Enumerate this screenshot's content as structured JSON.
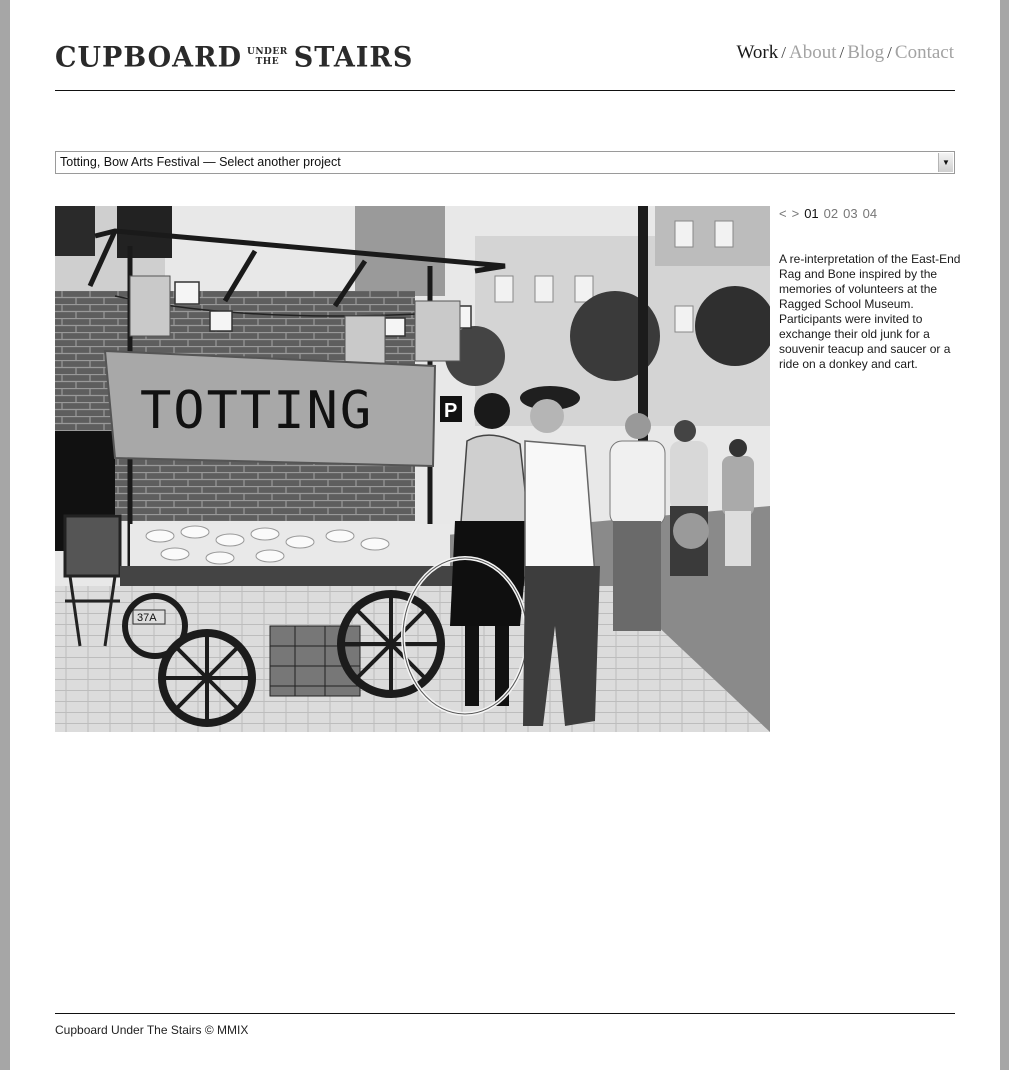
{
  "header": {
    "logo_left": "CUPBOARD",
    "logo_top": "UNDER",
    "logo_mid": "THE",
    "logo_right": "STAIRS",
    "nav": [
      {
        "label": "Work",
        "active": true
      },
      {
        "label": "About",
        "active": false
      },
      {
        "label": "Blog",
        "active": false
      },
      {
        "label": "Contact",
        "active": false
      }
    ],
    "separator": "/"
  },
  "project_select": {
    "value": "Totting, Bow Arts Festival — Select another project",
    "arrow": "▼"
  },
  "photo": {
    "banner_text": "TOTTING",
    "sign_text": "P",
    "cart_number": "37A"
  },
  "pager": {
    "prev": "<",
    "next": ">",
    "pages": [
      "01",
      "02",
      "03",
      "04"
    ],
    "current": "01"
  },
  "description": "A re-interpretation of the East-End Rag and Bone inspired by the memories of volunteers at the Ragged School Museum. Participants were invited to exchange their old junk for a souvenir teacup and saucer or a ride on a donkey and cart.",
  "footer": {
    "text": "Cupboard Under The Stairs © MMIX"
  }
}
